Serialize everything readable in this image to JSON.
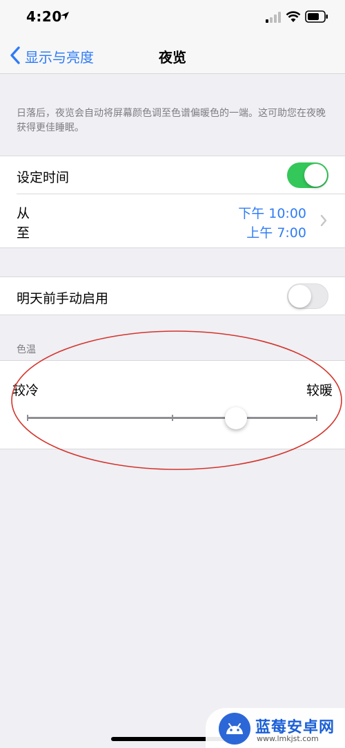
{
  "status_bar": {
    "time": "4:20"
  },
  "nav": {
    "back_label": "显示与亮度",
    "title": "夜览"
  },
  "description": "日落后，夜览会自动将屏幕颜色调至色谱偏暖色的一端。这可助您在夜晚获得更佳睡眠。",
  "schedule": {
    "label": "设定时间",
    "enabled": true,
    "from_label": "从",
    "to_label": "至",
    "from_value": "下午 10:00",
    "to_value": "上午 7:00"
  },
  "manual": {
    "label": "明天前手动启用",
    "enabled": false
  },
  "color_temperature": {
    "section_title": "色温",
    "min_label": "较冷",
    "max_label": "较暖",
    "value": 0.72
  },
  "annotation": {
    "color": "#d4332a"
  },
  "watermark": {
    "title": "蓝莓安卓网",
    "url": "www.lmkjst.com"
  },
  "colors": {
    "accent": "#2f7cf6",
    "toggle_on": "#34c759"
  }
}
